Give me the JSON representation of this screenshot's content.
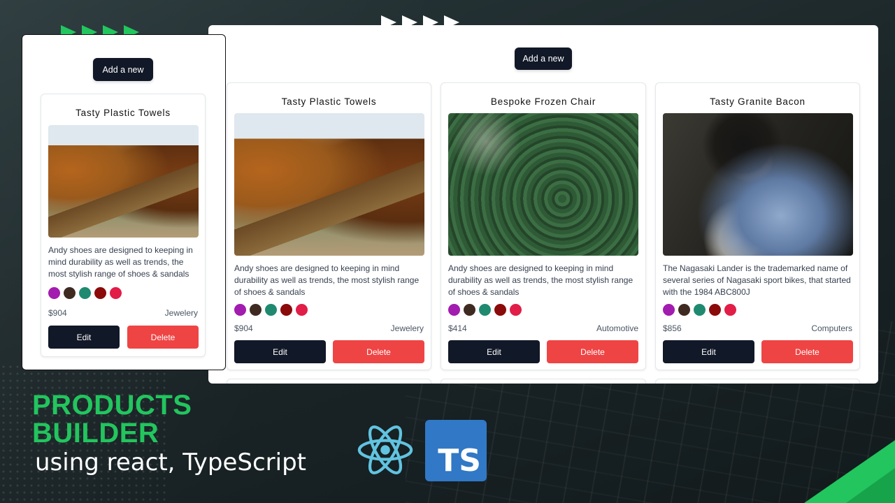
{
  "add_button": "Add a new",
  "products": [
    {
      "title": "Tasty Plastic Towels",
      "description": "Andy shoes are designed to keeping in mind durability as well as trends, the most stylish range of shoes & sandals",
      "price": "$904",
      "category": "Jewelery",
      "image": "autumn-lake-road"
    },
    {
      "title": "Bespoke Frozen Chair",
      "description": "Andy shoes are designed to keeping in mind durability as well as trends, the most stylish range of shoes & sandals",
      "price": "$414",
      "category": "Automotive",
      "image": "forest-cyclist"
    },
    {
      "title": "Tasty Granite Bacon",
      "description": "The Nagasaki Lander is the trademarked name of several series of Nagasaki sport bikes, that started with the 1984 ABC800J",
      "price": "$856",
      "category": "Computers",
      "image": "woman-reading"
    }
  ],
  "swatch_colors": [
    "#a21caf",
    "#3f2a22",
    "#1f8a70",
    "#8b0a0a",
    "#e11d48"
  ],
  "edit_label": "Edit",
  "delete_label": "Delete",
  "headline": [
    "PRODUCTS",
    "BUILDER"
  ],
  "subline": "using react, TypeScript",
  "ts_logo_text": "TS",
  "colors": {
    "accent_green": "#22c55e",
    "button_dark": "#111827",
    "button_red": "#ef4444",
    "react_blue": "#61c3e0",
    "ts_blue": "#3178c6"
  }
}
